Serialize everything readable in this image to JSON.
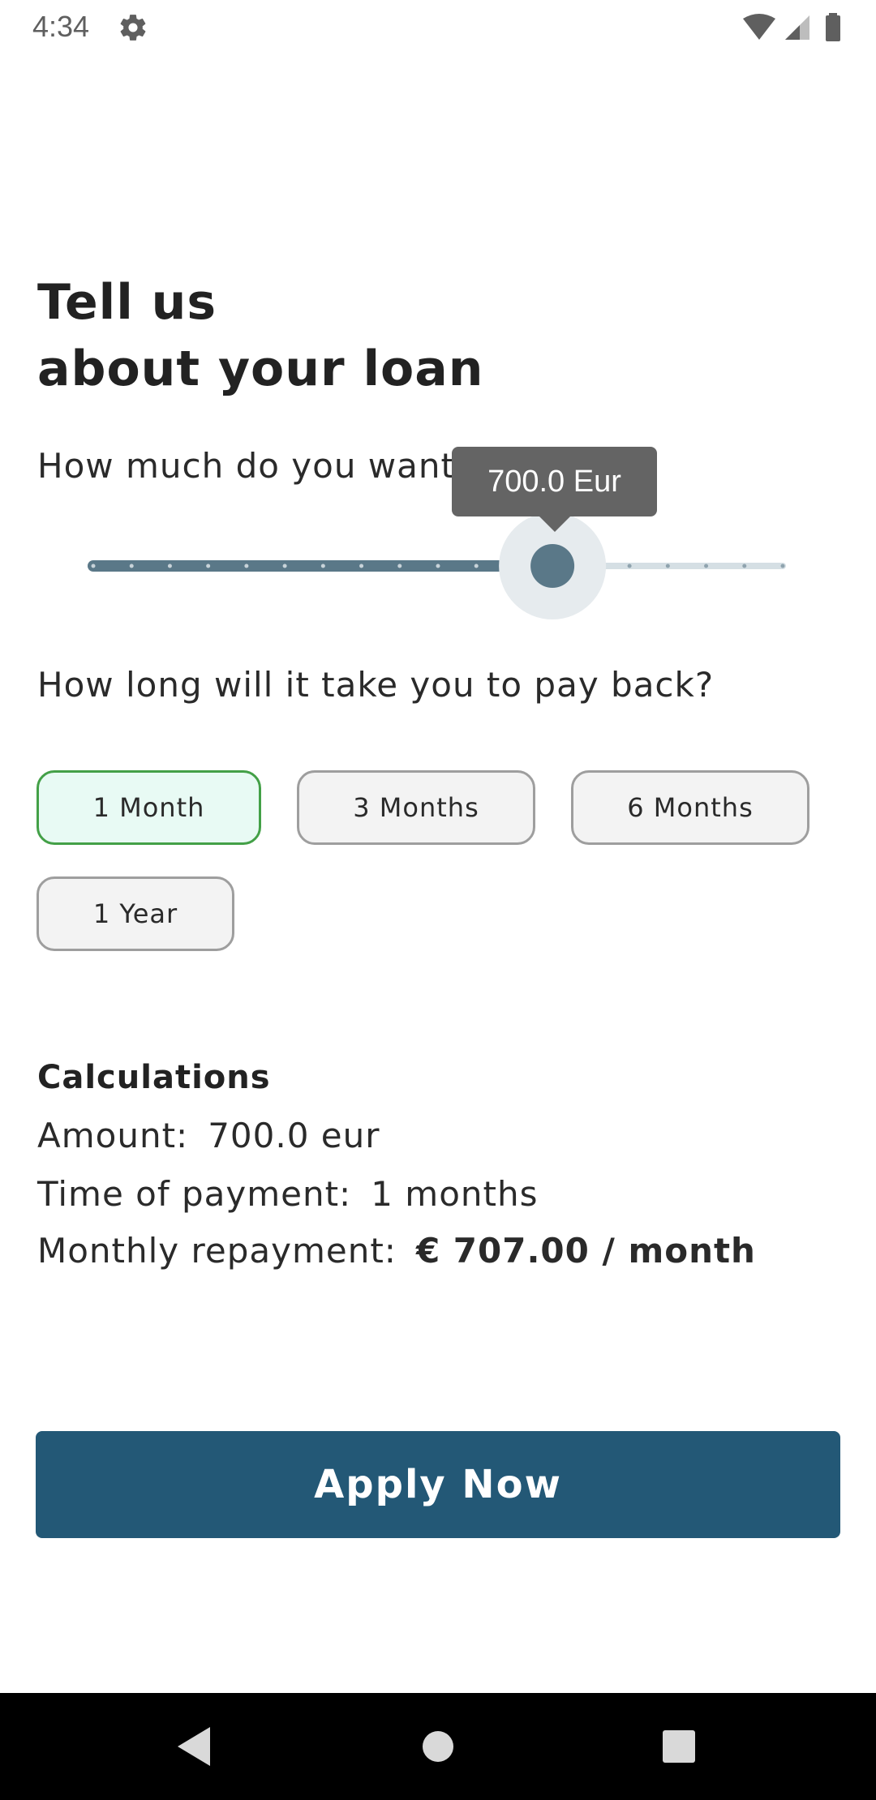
{
  "status_bar": {
    "time": "4:34",
    "icons": [
      "gear-icon",
      "wifi-icon",
      "cellular-signal-icon",
      "battery-icon"
    ]
  },
  "title": {
    "line1": "Tell us",
    "line2": "about your loan"
  },
  "amount_question": "How much do you want?",
  "slider": {
    "value_label": "700.0 Eur",
    "value": 700.0,
    "fraction": 0.666,
    "ticks": 19,
    "active_color": "#5a7888",
    "inactive_color": "#d5dfe4"
  },
  "period_question": "How long will it take you to pay back?",
  "periods": [
    {
      "label": "1 Month",
      "selected": true
    },
    {
      "label": "3 Months",
      "selected": false
    },
    {
      "label": "6 Months",
      "selected": false
    },
    {
      "label": "1 Year",
      "selected": false
    }
  ],
  "calculations": {
    "heading": "Calculations",
    "amount_label": "Amount:",
    "amount_value": "700.0 eur",
    "time_label": "Time of payment:",
    "time_value": "1 months",
    "monthly_label": "Monthly repayment:",
    "monthly_value": "€ 707.00 / month"
  },
  "apply_button": {
    "label": "Apply Now",
    "color": "#235876"
  },
  "nav_bar": {
    "icons": [
      "back-icon",
      "home-icon",
      "recents-icon"
    ]
  }
}
